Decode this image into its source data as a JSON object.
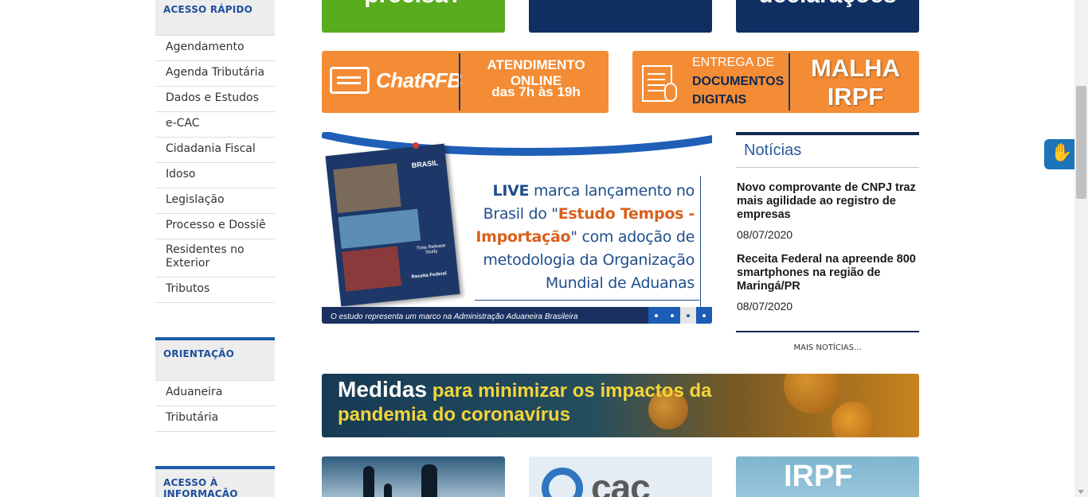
{
  "sidebar": {
    "acesso_rapido": {
      "title": "ACESSO RÁPIDO",
      "items": [
        "Agendamento",
        "Agenda Tributária",
        "Dados e Estudos",
        "e-CAC",
        "Cidadania Fiscal",
        "Idoso",
        "Legislação",
        "Processo e Dossiê",
        "Residentes no Exterior",
        "Tributos"
      ]
    },
    "orientacao": {
      "title": "ORIENTAÇÃO",
      "items": [
        "Aduaneira",
        "Tributária"
      ]
    },
    "acesso_informacao": {
      "title": "ACESSO À INFORMAÇÃO"
    }
  },
  "tiles_top": {
    "green_text": "precisa?",
    "navy3_text": "declarações"
  },
  "chat": {
    "label": "ChatRFB",
    "line1": "ATENDIMENTO ONLINE",
    "line2": "das 7h às 19h"
  },
  "malha": {
    "line1": "ENTREGA DE",
    "line2": "DOCUMENTOS",
    "line3": "DIGITAIS",
    "big1": "MALHA",
    "big2": "IRPF"
  },
  "carousel": {
    "book_title": "BRASIL",
    "book_subtitle": "Time Release Study",
    "book_logo": "Receita Federal",
    "headline_live": "LIVE",
    "headline_part1": " marca lançamento no Brasil do \"",
    "headline_emph": "Estudo Tempos - Importação",
    "headline_part2": "\" com adoção de metodologia da Organização Mundial de Aduanas",
    "caption": "O estudo representa um marco na Administração Aduaneira Brasileira",
    "active_slide": 3
  },
  "news": {
    "title": "Notícias",
    "items": [
      {
        "headline": "Novo comprovante de CNPJ traz mais agilidade ao registro de empresas",
        "date": "08/07/2020"
      },
      {
        "headline": "Receita Federal na apreende 800 smartphones na região de Maringá/PR",
        "date": "08/07/2020"
      }
    ],
    "more_label": "MAIS NOTÍCIAS..."
  },
  "banner": {
    "word1": "Medidas",
    "rest1": " para minimizar os impactos da",
    "line2": "pandemia do coronavírus"
  },
  "bottom_tiles": {
    "ecac_text": "cac",
    "irpf_text": "IRPF"
  },
  "colors": {
    "accent_blue": "#1c5daa",
    "orange": "#f38c35",
    "navy": "#0f2f63",
    "green": "#59ac1e"
  }
}
